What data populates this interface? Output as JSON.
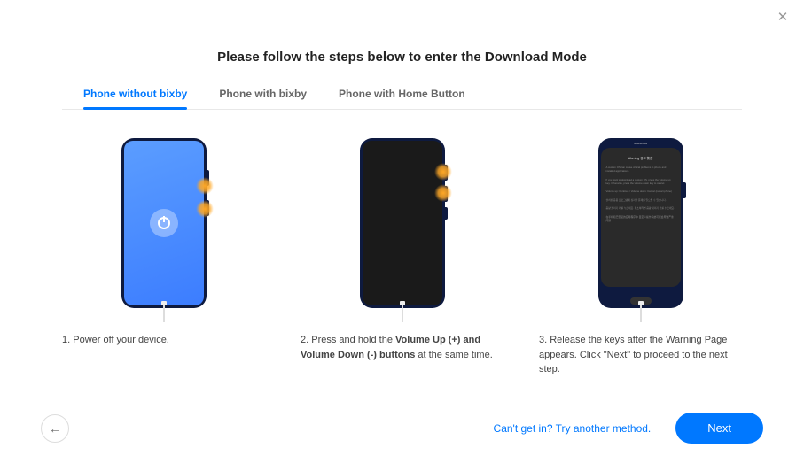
{
  "title": "Please follow the steps below to enter the Download Mode",
  "tabs": [
    {
      "label": "Phone without bixby",
      "active": true
    },
    {
      "label": "Phone with bixby",
      "active": false
    },
    {
      "label": "Phone with Home Button",
      "active": false
    }
  ],
  "steps": {
    "s1": {
      "prefix": "1. ",
      "text": "Power off your device."
    },
    "s2": {
      "prefix": "2. ",
      "pre": "Press and hold the ",
      "bold": "Volume Up (+) and Volume Down (-) buttons",
      "post": " at the same time."
    },
    "s3": {
      "prefix": "3. ",
      "text": "Release the keys after the Warning Page appears. Click \"Next\" to proceed to the next step."
    }
  },
  "warning_screen": {
    "brand": "SAMSUNG",
    "title": "Warning 경고 警告",
    "p1": "A custom OS can cause critical problems in phone and installed applications.",
    "p2": "If you want to download a custom OS, press the volume up key. Otherwise, press the volume down key to cancel.",
    "p3": "Volume up: Continue / Volume down: Cancel (restart phone)",
    "p4": "설치된 응용 프로그램에 심각한 문제를 일으킬 수 있습니다.",
    "p5": "음량 올리기 키를 누르세요. 취소하려면 음량 내리기 키를 누르세요.",
    "p6": "在手机和已安装的应用程序中 自定义操作系统可能会导致严重问题"
  },
  "footer": {
    "alt_link": "Can't get in? Try another method.",
    "next": "Next"
  }
}
